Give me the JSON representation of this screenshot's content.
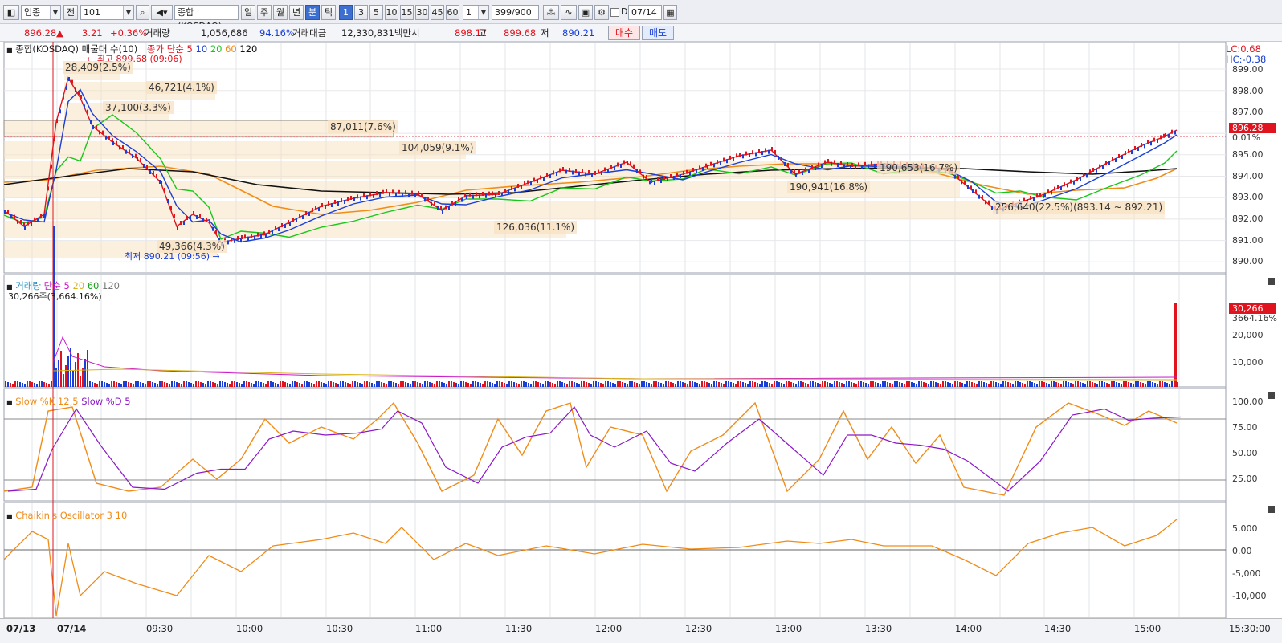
{
  "toolbar": {
    "category": "업종",
    "jeon": "전",
    "code": "101",
    "name": "종합(KOSDAQ)",
    "periods": [
      "일",
      "주",
      "월",
      "년",
      "분",
      "틱"
    ],
    "active_period": "분",
    "intervals": [
      "1",
      "3",
      "5",
      "10",
      "15",
      "30",
      "45",
      "60"
    ],
    "active_interval": "1",
    "n_value": "1",
    "count": "399",
    "count_total": "/900",
    "d_label": "D",
    "date": "07/14"
  },
  "quote": {
    "price": "896.28",
    "arrow": "▲",
    "change": "3.21",
    "change_pct": "+0.36%",
    "volume_label": "거래량",
    "volume": "1,056,686",
    "volume_pct": "94.16%",
    "amount_label": "거래대금",
    "amount": "12,330,831백만",
    "open_label": "시",
    "open": "898.17",
    "high_label": "고",
    "high": "899.68",
    "low_label": "저",
    "low": "890.21",
    "buy_label": "매수",
    "sell_label": "매도"
  },
  "price_pane": {
    "title": "종합(KOSDAQ) 매물대 수(10)",
    "ma_title": "종가 단순",
    "ma_periods": [
      "5",
      "10",
      "20",
      "60",
      "120"
    ],
    "ma_colors": [
      "#e0141e",
      "#1a3fd6",
      "#18c818",
      "#f08c18",
      "#111111"
    ],
    "lc": "LC:0.68",
    "hc": "HC:-0.38",
    "high_note": "최고 899.68 (09:06)",
    "low_note": "최저 890.21 (09:56)",
    "current_label": "896.28",
    "current_pct": "0.01%",
    "y_ticks": [
      "899.00",
      "898.00",
      "897.00",
      "896.00",
      "895.00",
      "894.00",
      "893.00",
      "892.00",
      "891.00",
      "890.00"
    ],
    "profile": [
      {
        "label": "28,409(2.5%)"
      },
      {
        "label": "46,721(4.1%)"
      },
      {
        "label": "37,100(3.3%)"
      },
      {
        "label": "87,011(7.6%)"
      },
      {
        "label": "104,059(9.1%)"
      },
      {
        "label": "190,653(16.7%)"
      },
      {
        "label": "190,941(16.8%)"
      },
      {
        "label": "126,036(11.1%)"
      },
      {
        "label": "256,640(22.5%)(893.14 ~ 892.21)"
      },
      {
        "label": "49,366(4.3%)"
      }
    ]
  },
  "volume_pane": {
    "title": "거래량",
    "ma_title": "단순",
    "ma_periods": [
      "5",
      "20",
      "60",
      "120"
    ],
    "sub": "30,266주(3,664.16%)",
    "current": "30,266",
    "current_pct": "3664.16%",
    "y_ticks": [
      "20,000",
      "10,000"
    ]
  },
  "stoch_pane": {
    "title1": "Slow %K 12,5",
    "title2": "Slow %D 5",
    "y_ticks": [
      "100.00",
      "75.00",
      "50.00",
      "25.00"
    ]
  },
  "chaikin_pane": {
    "title": "Chaikin's Oscillator 3 10",
    "y_ticks": [
      "5,000",
      "0.00",
      "-5,000",
      "-10,000"
    ]
  },
  "x_axis": {
    "labels": [
      "07/13",
      "07/14",
      "09:30",
      "10:00",
      "10:30",
      "11:00",
      "11:30",
      "12:00",
      "12:30",
      "13:00",
      "13:30",
      "14:00",
      "14:30",
      "15:00",
      "15:30:00"
    ]
  }
}
